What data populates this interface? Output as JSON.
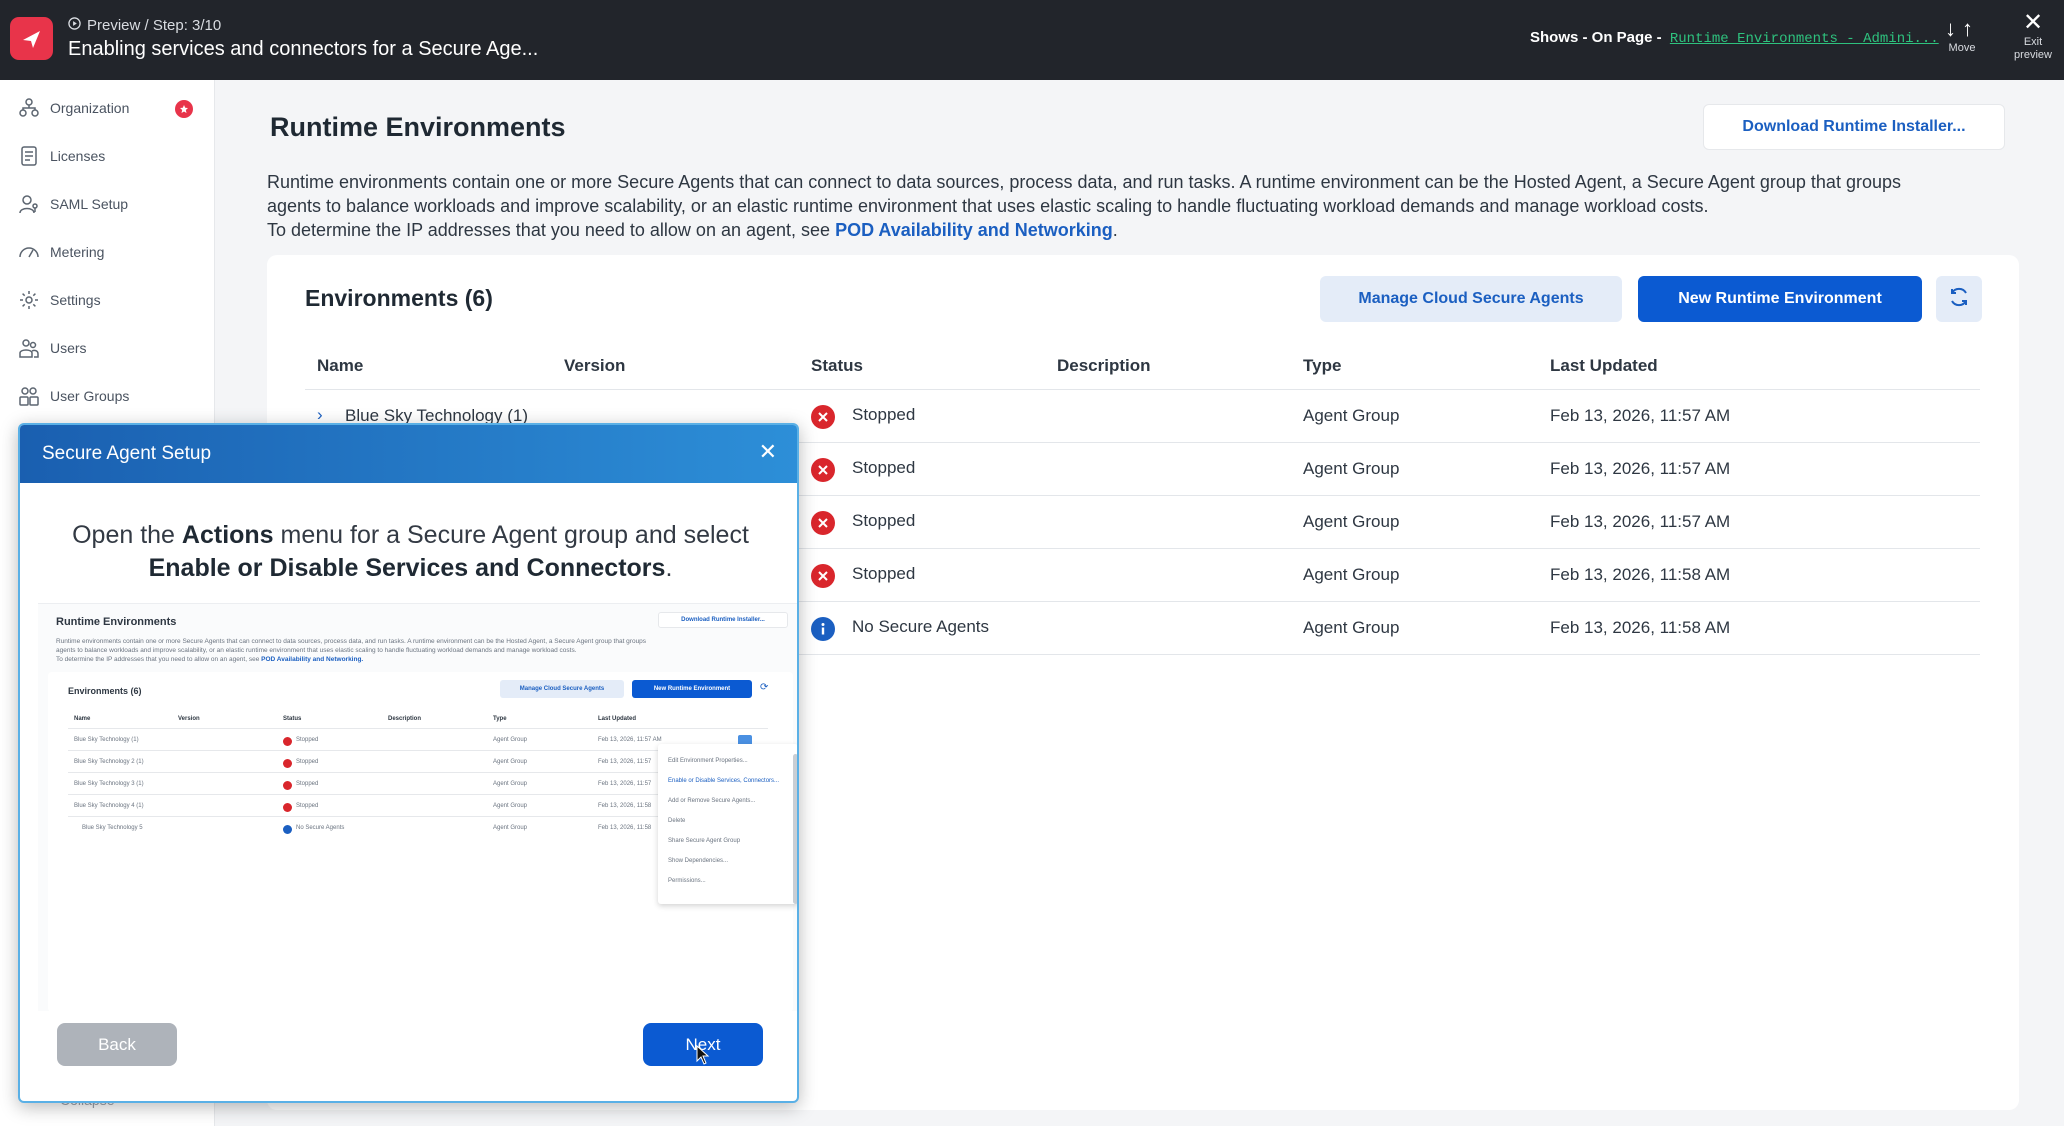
{
  "topbar": {
    "step": "Preview / Step: 3/10",
    "title": "Enabling services and connectors for a Secure Age...",
    "shows_label": "Shows - On Page -",
    "shows_link": "Runtime Environments - Admini...",
    "move_label": "Move",
    "exit_label_1": "Exit",
    "exit_label_2": "preview"
  },
  "sidebar": {
    "items": [
      {
        "label": "Organization",
        "icon": "organization-icon"
      },
      {
        "label": "Licenses",
        "icon": "document-icon"
      },
      {
        "label": "SAML Setup",
        "icon": "user-key-icon"
      },
      {
        "label": "Metering",
        "icon": "gauge-icon"
      },
      {
        "label": "Settings",
        "icon": "gear-icon"
      },
      {
        "label": "Users",
        "icon": "users-icon"
      },
      {
        "label": "User Groups",
        "icon": "user-groups-icon"
      }
    ],
    "collapse_label": "Collapse"
  },
  "main": {
    "title": "Runtime Environments",
    "download_button": "Download Runtime Installer...",
    "description_line1": "Runtime environments contain one or more Secure Agents that can connect to data sources, process data, and run tasks. A runtime environment can be the Hosted Agent, a Secure Agent group that groups",
    "description_line2": "agents to balance workloads and improve scalability, or an elastic runtime environment that uses elastic scaling to handle fluctuating workload demands and manage workload costs.",
    "description_line3": "To determine the IP addresses that you need to allow on an agent, see",
    "description_link": "POD Availability and Networking",
    "description_end": "."
  },
  "environments": {
    "title": "Environments (6)",
    "manage_button": "Manage Cloud Secure Agents",
    "new_button": "New Runtime Environment",
    "columns": [
      "Name",
      "Version",
      "Status",
      "Description",
      "Type",
      "Last Updated"
    ],
    "rows": [
      {
        "name": "Blue Sky Technology (1)",
        "status": "Stopped",
        "status_kind": "error",
        "type": "Agent Group",
        "updated": "Feb 13, 2026, 11:57 AM"
      },
      {
        "name": "",
        "status": "Stopped",
        "status_kind": "error",
        "type": "Agent Group",
        "updated": "Feb 13, 2026, 11:57 AM"
      },
      {
        "name": "",
        "status": "Stopped",
        "status_kind": "error",
        "type": "Agent Group",
        "updated": "Feb 13, 2026, 11:57 AM"
      },
      {
        "name": "",
        "status": "Stopped",
        "status_kind": "error",
        "type": "Agent Group",
        "updated": "Feb 13, 2026, 11:58 AM"
      },
      {
        "name": "",
        "status": "No Secure Agents",
        "status_kind": "info",
        "type": "Agent Group",
        "updated": "Feb 13, 2026, 11:58 AM"
      }
    ]
  },
  "modal": {
    "title": "Secure Agent Setup",
    "text_1": "Open the ",
    "text_bold_1": "Actions",
    "text_2": " menu for a Secure Agent group and select",
    "text_bold_2": "Enable or Disable Services and Connectors",
    "text_3": ".",
    "back_button": "Back",
    "next_button": "Next",
    "preview": {
      "title": "Runtime Environments",
      "download": "Download Runtime Installer...",
      "desc_1": "Runtime environments contain one or more Secure Agents that can connect to data sources, process data, and run tasks. A runtime environment can be the Hosted Agent, a Secure Agent group that groups",
      "desc_2": "agents to balance workloads and improve scalability, or an elastic runtime environment that uses elastic scaling to handle fluctuating workload demands and manage workload costs.",
      "desc_3": "To determine the IP addresses that you need to allow on an agent, see",
      "desc_link": "POD Availability and Networking.",
      "env_title": "Environments (6)",
      "manage": "Manage Cloud Secure Agents",
      "new_env": "New Runtime Environment",
      "cols": [
        "Name",
        "Version",
        "Status",
        "Description",
        "Type",
        "Last Updated"
      ],
      "rows": [
        {
          "name": "Blue Sky Technology (1)",
          "status": "Stopped",
          "type": "Agent Group",
          "updated": "Feb 13, 2026, 11:57 AM"
        },
        {
          "name": "Blue Sky Technology 2 (1)",
          "status": "Stopped",
          "type": "Agent Group",
          "updated": "Feb 13, 2026, 11:57"
        },
        {
          "name": "Blue Sky Technology 3 (1)",
          "status": "Stopped",
          "type": "Agent Group",
          "updated": "Feb 13, 2026, 11:57"
        },
        {
          "name": "Blue Sky Technology 4 (1)",
          "status": "Stopped",
          "type": "Agent Group",
          "updated": "Feb 13, 2026, 11:58"
        },
        {
          "name": "Blue Sky Technology 5",
          "status": "No Secure Agents",
          "type": "Agent Group",
          "updated": "Feb 13, 2026, 11:58"
        }
      ],
      "menu": [
        "Edit Environment Properties...",
        "Enable or Disable Services, Connectors...",
        "Add or Remove Secure Agents...",
        "Delete",
        "Share Secure Agent Group",
        "Show Dependencies...",
        "Permissions..."
      ]
    }
  },
  "colors": {
    "accent": "#0b5ad2",
    "error": "#d9262c",
    "info": "#1b5fc1",
    "topbar": "#22252b"
  }
}
